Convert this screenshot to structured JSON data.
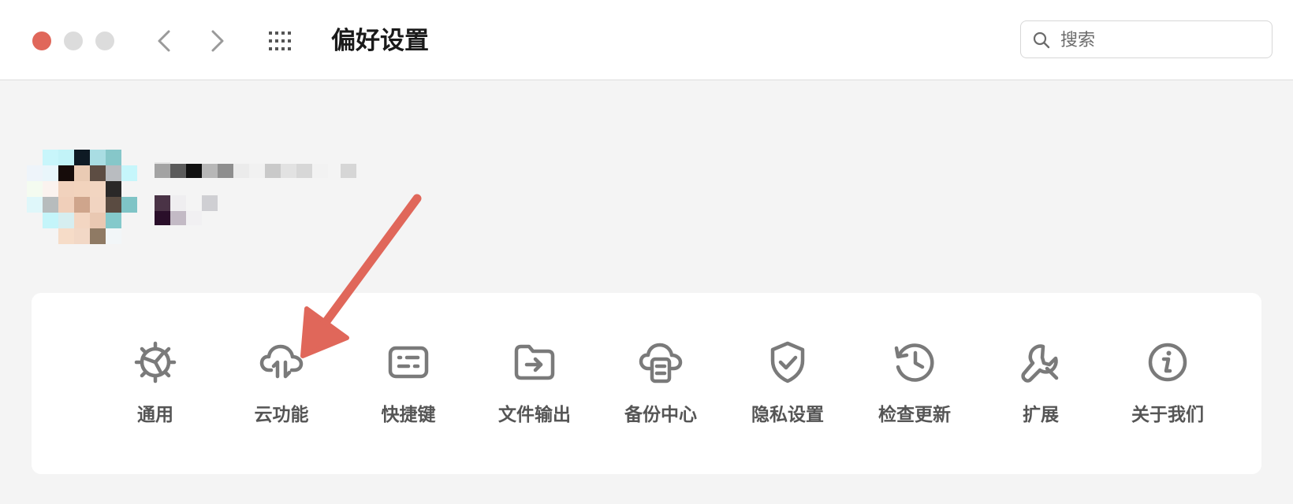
{
  "window": {
    "title": "偏好设置"
  },
  "search": {
    "placeholder": "搜索"
  },
  "settings_items": [
    {
      "label": "通用",
      "icon": "gear-icon"
    },
    {
      "label": "云功能",
      "icon": "cloud-sync-icon"
    },
    {
      "label": "快捷键",
      "icon": "keyboard-icon"
    },
    {
      "label": "文件输出",
      "icon": "folder-export-icon"
    },
    {
      "label": "备份中心",
      "icon": "cloud-backup-icon"
    },
    {
      "label": "隐私设置",
      "icon": "shield-check-icon"
    },
    {
      "label": "检查更新",
      "icon": "history-clock-icon"
    },
    {
      "label": "扩展",
      "icon": "wrench-icon"
    },
    {
      "label": "关于我们",
      "icon": "info-icon"
    }
  ],
  "colors": {
    "close_button": "#e0675a",
    "annotation_arrow": "#e0675a",
    "icon_gray": "#7a7a7a"
  }
}
